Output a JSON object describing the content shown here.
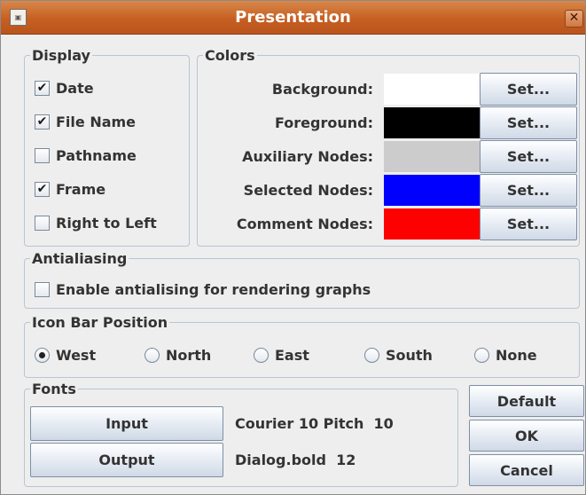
{
  "window": {
    "title": "Presentation",
    "close_glyph": "✕",
    "app_icon": "application-icon"
  },
  "display": {
    "legend": "Display",
    "items": [
      {
        "label": "Date",
        "checked": true
      },
      {
        "label": "File Name",
        "checked": true
      },
      {
        "label": "Pathname",
        "checked": false
      },
      {
        "label": "Frame",
        "checked": true
      },
      {
        "label": "Right to Left",
        "checked": false
      }
    ]
  },
  "colors": {
    "legend": "Colors",
    "set_label": "Set...",
    "rows": [
      {
        "label": "Background:",
        "swatch": "#ffffff"
      },
      {
        "label": "Foreground:",
        "swatch": "#000000"
      },
      {
        "label": "Auxiliary Nodes:",
        "swatch": "#cccccc"
      },
      {
        "label": "Selected Nodes:",
        "swatch": "#0000ff"
      },
      {
        "label": "Comment Nodes:",
        "swatch": "#ff0000"
      }
    ]
  },
  "antialiasing": {
    "legend": "Antialiasing",
    "checkbox_label": "Enable antialising for rendering graphs",
    "checked": false
  },
  "icon_bar": {
    "legend": "Icon Bar Position",
    "options": [
      {
        "label": "West",
        "selected": true
      },
      {
        "label": "North",
        "selected": false
      },
      {
        "label": "East",
        "selected": false
      },
      {
        "label": "South",
        "selected": false
      },
      {
        "label": "None",
        "selected": false
      }
    ]
  },
  "fonts": {
    "legend": "Fonts",
    "input_button": "Input",
    "input_font": "Courier 10 Pitch  10",
    "output_button": "Output",
    "output_font": "Dialog.bold  12"
  },
  "actions": {
    "default": "Default",
    "ok": "OK",
    "cancel": "Cancel"
  },
  "theme": {
    "titlebar": "#c65f22",
    "button_face": "#dce5ef",
    "group_border": "#b9c5d3"
  }
}
